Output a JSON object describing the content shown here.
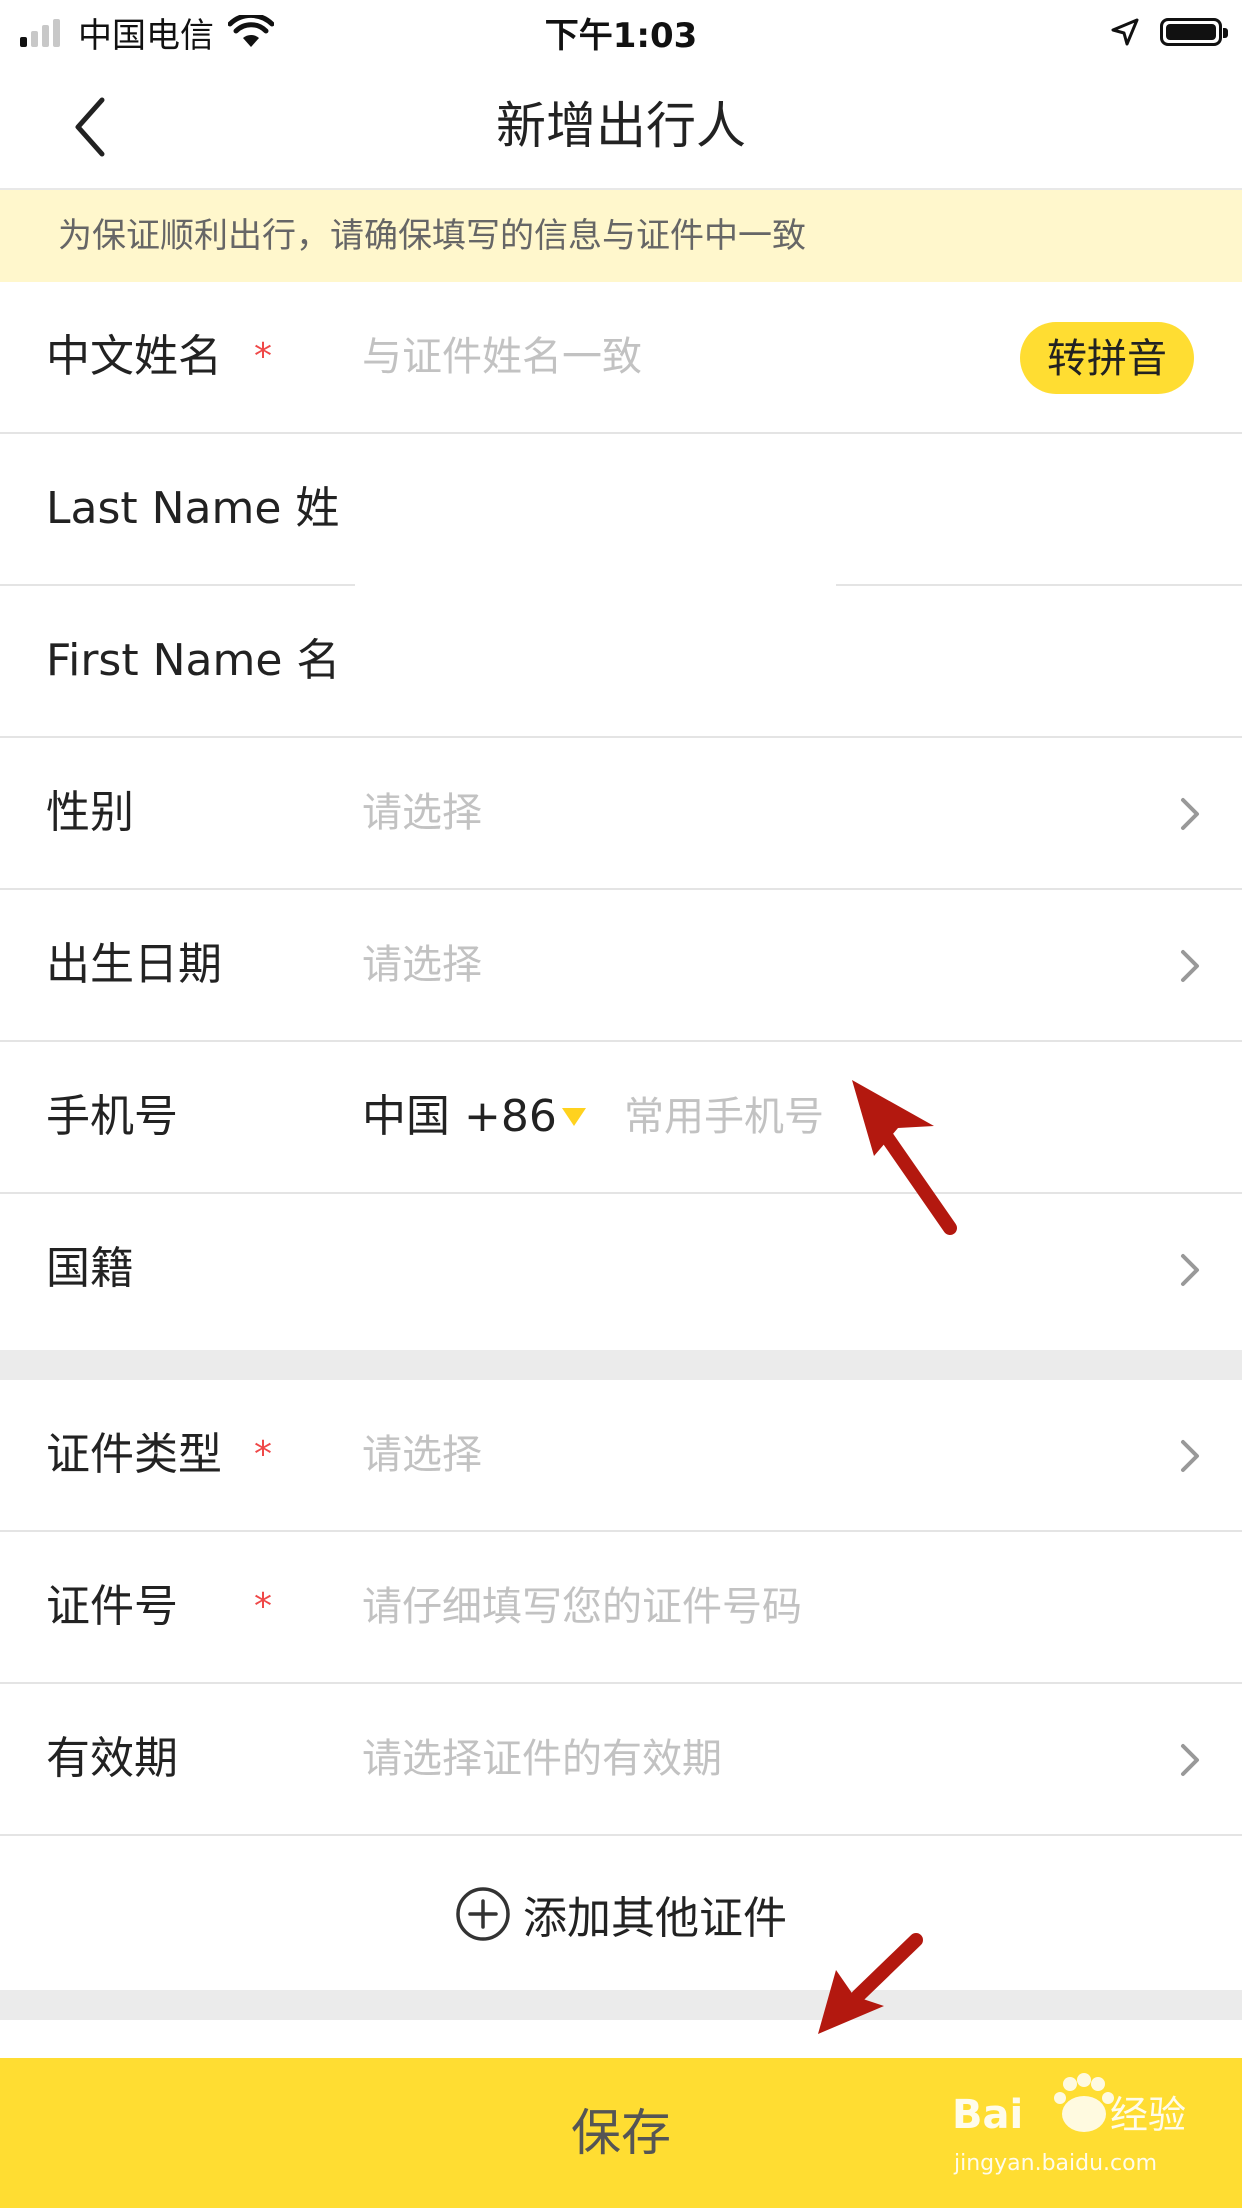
{
  "status_bar": {
    "carrier": "中国电信",
    "time": "下午1:03"
  },
  "nav": {
    "title": "新增出行人"
  },
  "notice": "为保证顺利出行，请确保填写的信息与证件中一致",
  "fields": {
    "chinese_name": {
      "label": "中文姓名",
      "required": "*",
      "placeholder": "与证件姓名一致",
      "button": "转拼音"
    },
    "last_name": {
      "label": "Last Name 姓"
    },
    "first_name": {
      "label": "First Name 名"
    },
    "gender": {
      "label": "性别",
      "placeholder": "请选择"
    },
    "birthdate": {
      "label": "出生日期",
      "placeholder": "请选择"
    },
    "phone": {
      "label": "手机号",
      "country_code": "中国 +86",
      "placeholder": "常用手机号"
    },
    "nationality": {
      "label": "国籍"
    },
    "id_type": {
      "label": "证件类型",
      "required": "*",
      "placeholder": "请选择"
    },
    "id_number": {
      "label": "证件号",
      "required": "*",
      "placeholder": "请仔细填写您的证件号码"
    },
    "validity": {
      "label": "有效期",
      "placeholder": "请选择证件的有效期"
    }
  },
  "add_document": "添加其他证件",
  "save_button": "保存",
  "watermark": "Baidu经验 jingyan.baidu.com",
  "colors": {
    "accent": "#ffdd32",
    "required": "#ef4848",
    "notice_bg": "#fff7cc",
    "annotation_arrow": "#b3180f"
  }
}
